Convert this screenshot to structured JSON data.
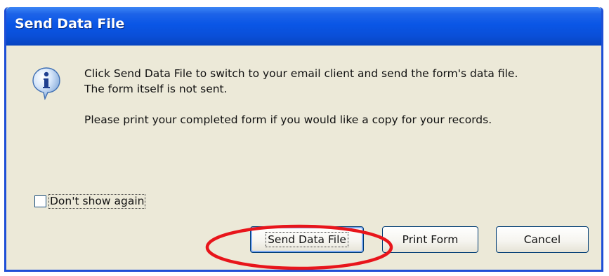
{
  "dialog": {
    "title": "Send Data File",
    "icon": "info-icon",
    "message_lines": [
      "Click Send Data File to switch to your email client and send the form's data file.",
      "The form itself is not sent."
    ],
    "message_note": "Please print your completed form if you would like a copy for your records.",
    "checkbox": {
      "label": "Don't show again",
      "checked": false
    },
    "buttons": {
      "send": "Send Data File",
      "print": "Print Form",
      "cancel": "Cancel"
    }
  },
  "colors": {
    "titlebar": "#0a56e6",
    "dialog_bg": "#ece9d8",
    "annotation": "#e8151b"
  }
}
